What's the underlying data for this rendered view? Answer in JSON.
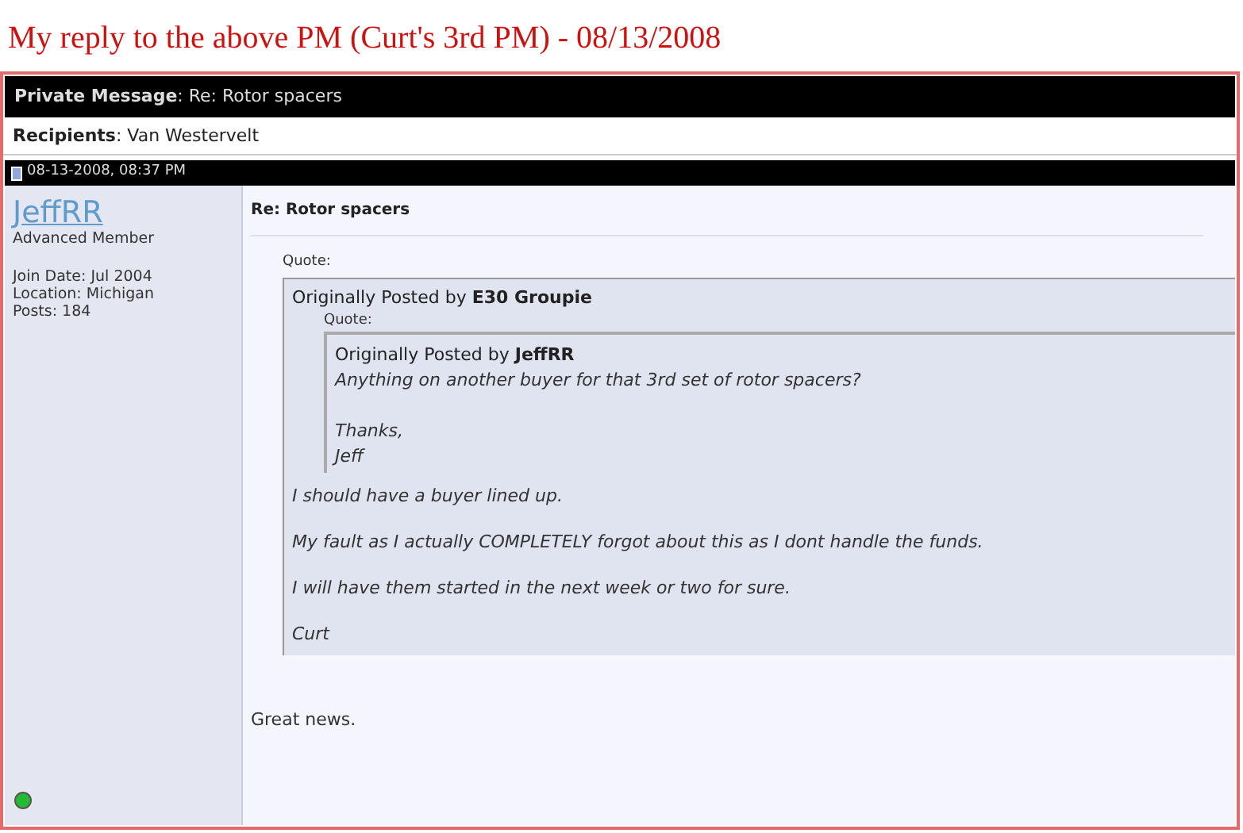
{
  "page_title": "My reply to the above PM (Curt's 3rd PM) - 08/13/2008",
  "message": {
    "header": "**Private Message**: Re: Rotor spacers",
    "recipients": "**Recipients**: Van Westervelt",
    "date": "08-13-2008, 08:37 PM"
  },
  "user": {
    "name": "JeffRR",
    "rank": "Advanced Member",
    "details": [
      "Join Date: Jul 2004",
      "Location: Michigan",
      "Posts: 184"
    ],
    "online": true
  },
  "post": {
    "title": "Re: Rotor spacers",
    "quote": {
      "label": "Quote:",
      "attribution": "Originally Posted by **E30 Groupie**",
      "inner_quote": {
        "label": "Quote:",
        "attribution": "Originally Posted by **JeffRR**",
        "paragraphs": [
          [
            "Anything on another buyer for that 3rd set of rotor spacers?"
          ],
          [
            "Thanks,",
            "Jeff"
          ]
        ]
      },
      "paragraphs": [
        "I should have a buyer lined up.",
        "My fault as I actually COMPLETELY forgot about this as I dont handle the funds.",
        "I will have them started in the next week or two for sure.",
        "Curt"
      ]
    },
    "body": "Great news."
  }
}
